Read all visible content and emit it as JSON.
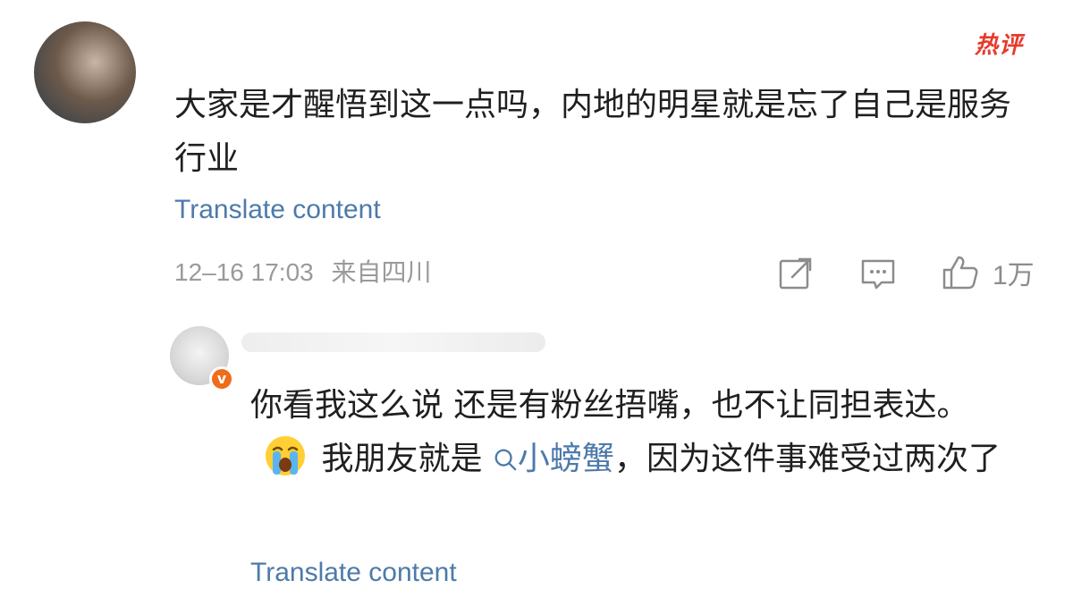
{
  "comment": {
    "hot_badge": "热评",
    "text": "大家是才醒悟到这一点吗，内地的明星就是忘了自己是服务行业",
    "translate_label": "Translate content",
    "timestamp": "12–16 17:03",
    "location": "来自四川",
    "likes": "1万",
    "icons": [
      "share-icon",
      "comment-icon",
      "like-icon"
    ]
  },
  "reply": {
    "verified_mark": "v",
    "text_before_emoji": "你看我这么说 还是有粉丝捂嘴，也不让同担表达。",
    "emoji": "crying-face-emoji",
    "text_after_emoji": "我朋友就是",
    "mention": "小螃蟹",
    "text_after_mention": "，因为这件事难受过两次了",
    "translate_label": "Translate content"
  },
  "colors": {
    "link": "#4d7aaa",
    "badge": "#e8392b",
    "meta": "#9a9a9a",
    "verified": "#f06b1a"
  }
}
